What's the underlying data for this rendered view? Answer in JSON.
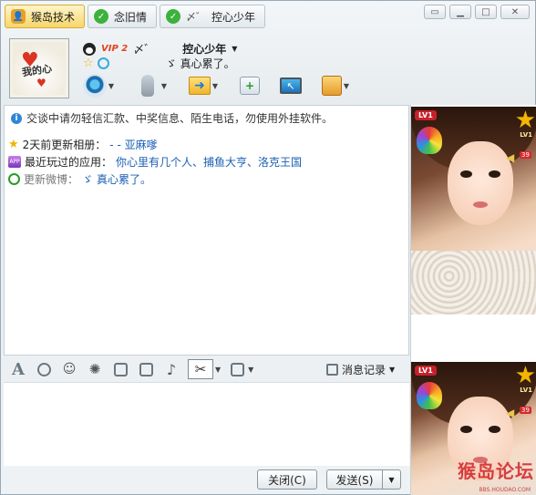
{
  "tabs": [
    {
      "label": "猴岛技术",
      "active": true
    },
    {
      "label": "念旧情",
      "active": false
    },
    {
      "label": "控心少年",
      "prefix": "〆゛",
      "active": false
    }
  ],
  "window_buttons": [
    "restore",
    "minimize",
    "maximize",
    "close"
  ],
  "profile": {
    "avatar_text": "我的心",
    "vip_label": "VIP 2",
    "nick_prefix": "〆゛",
    "nickname": "控心少年",
    "status_prefix": "ゞ",
    "status_message": "真心累了。"
  },
  "toolbar": {
    "items": [
      "video-call",
      "voice-call",
      "send-file",
      "create-discussion",
      "remote-assist",
      "app"
    ]
  },
  "chat": {
    "notice": "交谈中请勿轻信汇款、中奖信息、陌生电话，勿使用外挂软件。",
    "feed": {
      "album_prefix": "2天前更新相册：",
      "album_link": "- - 亚麻嗲",
      "app_prefix": "最近玩过的应用：",
      "app_link": "你心里有几个人、捕鱼大亨、洛克王国",
      "weibo_prefix": "更新微博：",
      "weibo_mark": "ゞ",
      "weibo_link": "真心累了。"
    }
  },
  "input_toolbar": {
    "history_label": "消息记录"
  },
  "buttons": {
    "close": "关闭(C)",
    "send": "发送(S)"
  },
  "side_panel": {
    "level_badge": "LV1",
    "level_star_text": "LV1",
    "badge_number": "39",
    "watermark": "猴岛论坛",
    "watermark_url": "BBS.HOUDAO.COM"
  }
}
